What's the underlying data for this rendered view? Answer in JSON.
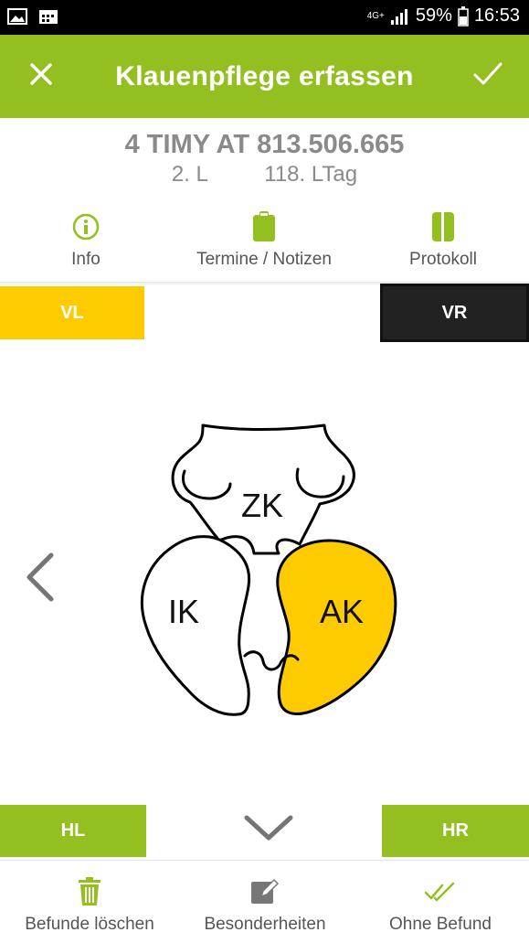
{
  "status": {
    "network": "4G+",
    "battery": "59%",
    "time": "16:53",
    "icons": [
      "image-icon",
      "calendar-icon",
      "signal-icon",
      "battery-icon"
    ]
  },
  "appbar": {
    "title": "Klauenpflege erfassen",
    "close_icon": "close-icon",
    "confirm_icon": "check-icon",
    "color": "#93c020"
  },
  "animal": {
    "name": "4 TIMY AT 813.506.665",
    "lactation": "2. L",
    "lactation_day": "118. LTag"
  },
  "tabs": [
    {
      "label": "Info",
      "icon": "info-icon"
    },
    {
      "label": "Termine / Notizen",
      "icon": "clipboard-icon"
    },
    {
      "label": "Protokoll",
      "icon": "book-icon"
    }
  ],
  "legs": {
    "vl": "VL",
    "vr": "VR",
    "hl": "HL",
    "hr": "HR"
  },
  "hoof": {
    "zk": "ZK",
    "ik": "IK",
    "ak": "AK",
    "highlight_color": "#fecb00"
  },
  "bottom": [
    {
      "label": "Befunde löschen",
      "icon": "trash-icon"
    },
    {
      "label": "Besonderheiten",
      "icon": "edit-icon"
    },
    {
      "label": "Ohne Befund",
      "icon": "double-check-icon"
    }
  ]
}
